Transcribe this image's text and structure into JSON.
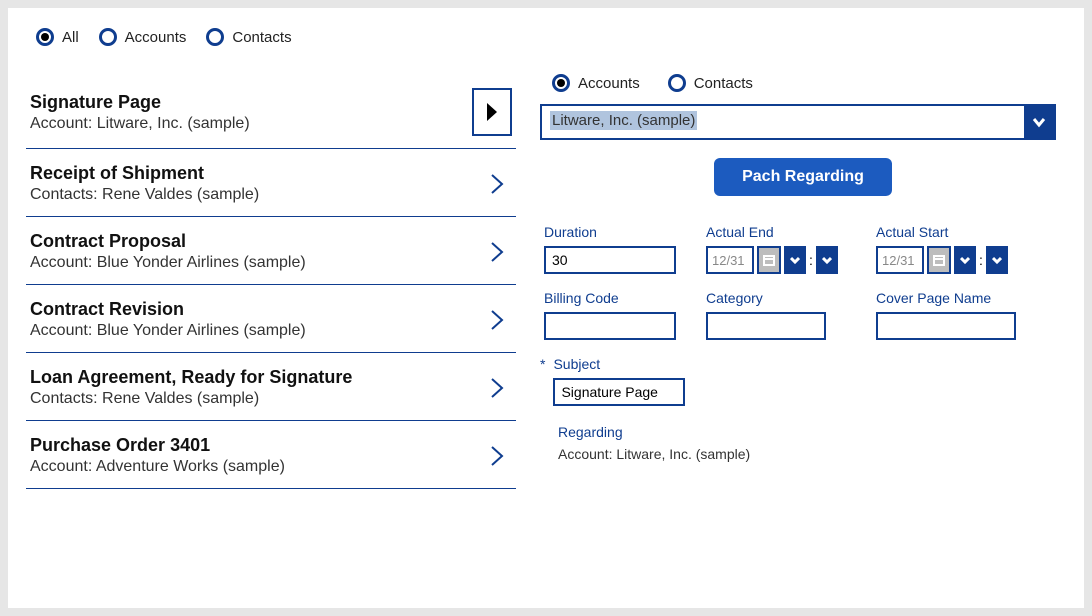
{
  "topFilter": {
    "options": [
      "All",
      "Accounts",
      "Contacts"
    ],
    "selected": "All"
  },
  "list": [
    {
      "title": "Signature Page",
      "sub": "Account: Litware, Inc. (sample)",
      "boxed": true
    },
    {
      "title": "Receipt of Shipment",
      "sub": "Contacts: Rene Valdes (sample)",
      "boxed": false
    },
    {
      "title": "Contract Proposal",
      "sub": "Account: Blue Yonder Airlines (sample)",
      "boxed": false
    },
    {
      "title": "Contract Revision",
      "sub": "Account: Blue Yonder Airlines (sample)",
      "boxed": false
    },
    {
      "title": "Loan Agreement, Ready for Signature",
      "sub": "Contacts: Rene Valdes (sample)",
      "boxed": false
    },
    {
      "title": "Purchase Order 3401",
      "sub": "Account: Adventure Works (sample)",
      "boxed": false
    }
  ],
  "detailFilter": {
    "options": [
      "Accounts",
      "Contacts"
    ],
    "selected": "Accounts"
  },
  "combo": {
    "value": "Litware, Inc. (sample)"
  },
  "primaryButton": "Pach Regarding",
  "form": {
    "duration": {
      "label": "Duration",
      "value": "30"
    },
    "actualEnd": {
      "label": "Actual End",
      "value": "12/31"
    },
    "actualStart": {
      "label": "Actual Start",
      "value": "12/31"
    },
    "billingCode": {
      "label": "Billing Code",
      "value": ""
    },
    "category": {
      "label": "Category",
      "value": ""
    },
    "coverPageName": {
      "label": "Cover Page Name",
      "value": ""
    },
    "subject": {
      "label": "Subject",
      "value": "Signature Page",
      "required": "*"
    },
    "regarding": {
      "label": "Regarding",
      "value": "Account: Litware, Inc. (sample)"
    }
  }
}
